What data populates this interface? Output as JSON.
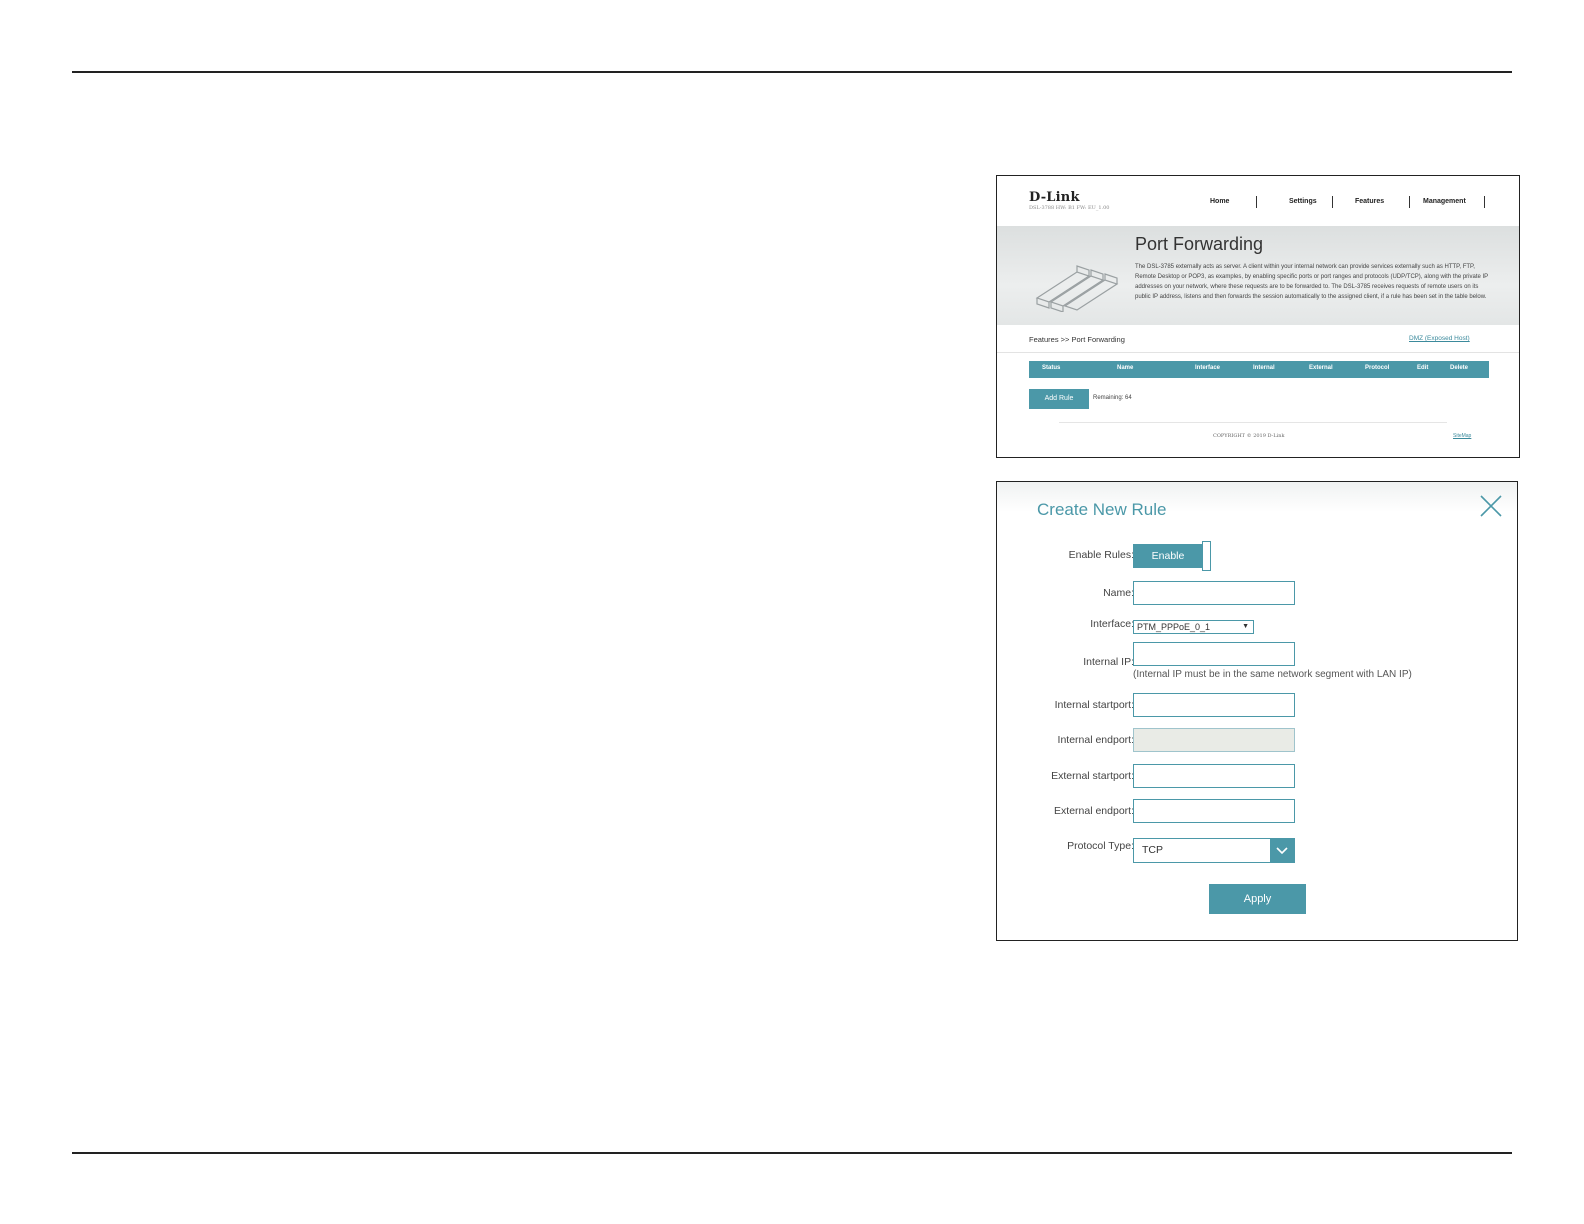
{
  "screenshot1": {
    "logo": "D-Link",
    "model": "DSL-3788 HW: B1 FW: EU_1.00",
    "nav": [
      "Home",
      "Settings",
      "Features",
      "Management"
    ],
    "title": "Port Forwarding",
    "description": "The DSL-3785 externally acts as server. A client within your internal network can provide services externally such as HTTP, FTP, Remote Desktop or POP3, as examples, by enabling specific ports or port ranges and protocols (UDP/TCP), along with the private IP addresses on your network, where these requests are to be forwarded to. The DSL-3785 receives requests of remote users on its public IP address, listens and then forwards the session automatically to the assigned client, if a rule has been set in the table below.",
    "breadcrumb": "Features >> Port Forwarding",
    "dmz_link": "DMZ (Exposed Host)",
    "table_headers": [
      "Status",
      "Name",
      "Interface",
      "Internal",
      "External",
      "Protocol",
      "Edit",
      "Delete"
    ],
    "add_rule_label": "Add Rule",
    "remaining": "Remaining: 64",
    "copyright": "COPYRIGHT © 2019 D-Link",
    "sitemap": "SiteMap"
  },
  "screenshot2": {
    "title": "Create New Rule",
    "enable_rules_label": "Enable Rules:",
    "enable_button": "Enable",
    "name_label": "Name:",
    "name_value": "",
    "interface_label": "Interface:",
    "interface_value": "PTM_PPPoE_0_1",
    "internal_ip_label": "Internal IP:",
    "internal_ip_value": "",
    "internal_ip_note": "(Internal IP must be in the same network segment with LAN IP)",
    "internal_startport_label": "Internal startport:",
    "internal_endport_label": "Internal endport:",
    "external_startport_label": "External startport:",
    "external_endport_label": "External endport:",
    "protocol_label": "Protocol Type:",
    "protocol_value": "TCP",
    "apply_label": "Apply"
  },
  "colors": {
    "accent": "#4b98a8",
    "text": "#333333"
  }
}
